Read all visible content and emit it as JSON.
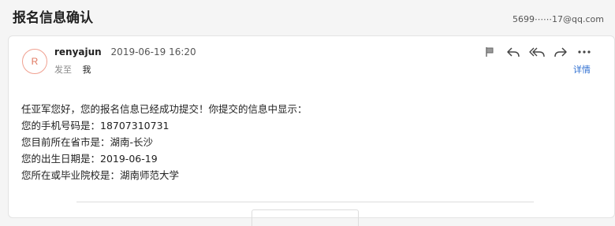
{
  "header": {
    "subject": "报名信息确认",
    "account": "5699⋯⋯17@qq.com"
  },
  "message": {
    "avatar_letter": "R",
    "sender_name": "renyajun",
    "timestamp": "2019-06-19 16:20",
    "to_label": "发至",
    "to_value": "我",
    "details_link": "详情"
  },
  "body": {
    "lines": [
      "任亚军您好，您的报名信息已经成功提交！你提交的信息中显示：",
      "您的手机号码是：18707310731",
      "您目前所在省市是：湖南-长沙",
      "您的出生日期是：2019-06-19",
      "您所在或毕业院校是：湖南师范大学"
    ]
  },
  "toolbar": {
    "icons": [
      "flag-icon",
      "reply-icon",
      "reply-all-icon",
      "forward-icon",
      "more-icon"
    ]
  }
}
